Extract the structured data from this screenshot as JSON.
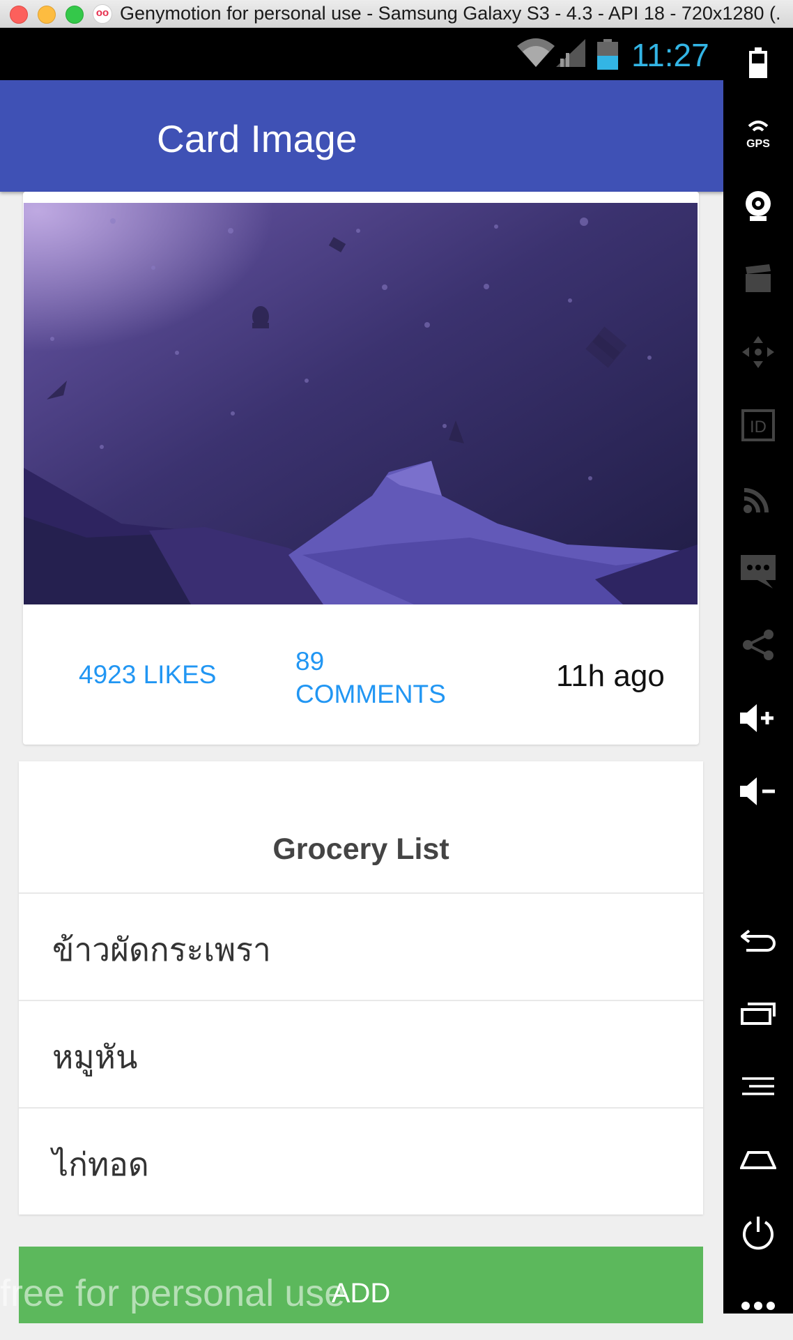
{
  "window": {
    "title": "Genymotion for personal use - Samsung Galaxy S3 - 4.3 - API 18 - 720x1280 (...",
    "app_logo": "oo"
  },
  "status_bar": {
    "time": "11:27",
    "icons": [
      "wifi-icon",
      "cell-signal-icon",
      "battery-icon"
    ],
    "accent_color": "#33b5e5"
  },
  "app_bar": {
    "title": "Card Image",
    "color": "#3f51b5"
  },
  "card": {
    "image": "night-sky-mountain-illustration",
    "likes": "4923 LIKES",
    "comments_count": "89",
    "comments_label": "COMMENTS",
    "time_ago": "11h ago",
    "link_color": "#2196f3"
  },
  "grocery": {
    "title": "Grocery List",
    "items": [
      "ข้าวผัดกระเพรา",
      "หมูหัน",
      "ไก่ทอด"
    ]
  },
  "add_button": {
    "label": "ADD",
    "color": "#5cb85c"
  },
  "watermark": "free for personal use",
  "side_toolbar": {
    "items": [
      "battery-icon",
      "gps-icon",
      "webcam-icon",
      "capture-icon",
      "dpad-icon",
      "id-icon",
      "network-icon",
      "sms-icon",
      "share-icon",
      "volume-up-icon",
      "volume-down-icon",
      "back-icon",
      "recent-apps-icon",
      "menu-icon",
      "home-icon",
      "power-icon",
      "more-icon"
    ],
    "gps_label": "GPS",
    "id_label": "ID"
  }
}
